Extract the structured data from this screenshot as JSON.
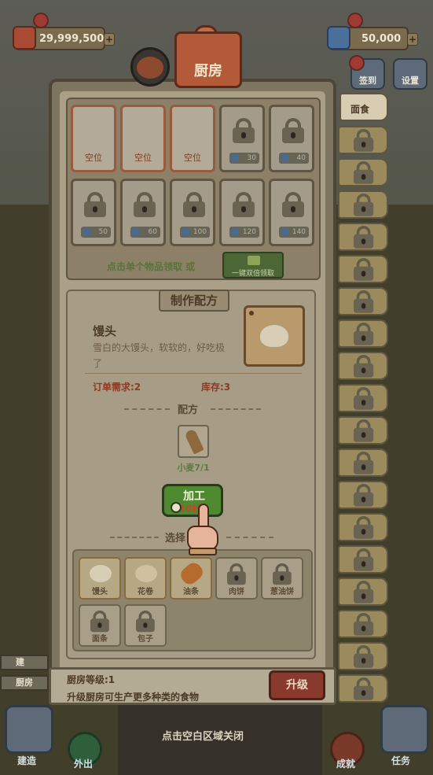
{
  "currency": {
    "coins": "29,999,500",
    "gems": "50,000",
    "plus": "+"
  },
  "top_right": {
    "sign_in": "签到",
    "settings": "设置"
  },
  "panel": {
    "title": "厨房"
  },
  "storage": {
    "open_slots": [
      {
        "label": "空位"
      },
      {
        "label": "空位"
      },
      {
        "label": "空位"
      }
    ],
    "locked_slots": [
      {
        "price": "30"
      },
      {
        "price": "40"
      },
      {
        "price": "50"
      },
      {
        "price": "60"
      },
      {
        "price": "100"
      },
      {
        "price": "120"
      },
      {
        "price": "140"
      }
    ],
    "hint": "点击单个物品领取 或",
    "claim_all": "一键双倍领取"
  },
  "recipe": {
    "title": "制作配方",
    "name": "馒头",
    "description": "雪白的大馒头，软软的，好吃极了",
    "order_need": "订单需求:2",
    "stock": "库存:3",
    "section": "配方",
    "ingredient": {
      "name": "小麦7/1"
    },
    "process_button": "加工",
    "process_time": "10秒",
    "select_label": "选择"
  },
  "food_options": [
    {
      "label": "馒头",
      "locked": false,
      "color": "#d8ceb5"
    },
    {
      "label": "花卷",
      "locked": false,
      "color": "#cfc0a0"
    },
    {
      "label": "油条",
      "locked": false,
      "color": "#b56a2e"
    },
    {
      "label": "肉饼",
      "locked": true
    },
    {
      "label": "葱油饼",
      "locked": true
    },
    {
      "label": "面条",
      "locked": true
    },
    {
      "label": "包子",
      "locked": true
    }
  ],
  "side_tabs": {
    "active": "面食",
    "locked_labels": [
      "",
      "",
      "",
      "",
      "",
      "",
      "",
      "",
      "",
      "",
      "",
      "",
      "",
      "",
      "",
      "",
      "",
      ""
    ]
  },
  "info_bar": {
    "level": "厨房等级:1",
    "description": "升级厨房可生产更多种类的食物",
    "upgrade": "升级"
  },
  "bottom": {
    "close_hint": "点击空白区域关闭",
    "build": "建造",
    "go_out": "外出",
    "achievement": "成就",
    "tasks": "任务"
  },
  "left_list": {
    "item1": "建",
    "item2": "厨房"
  }
}
